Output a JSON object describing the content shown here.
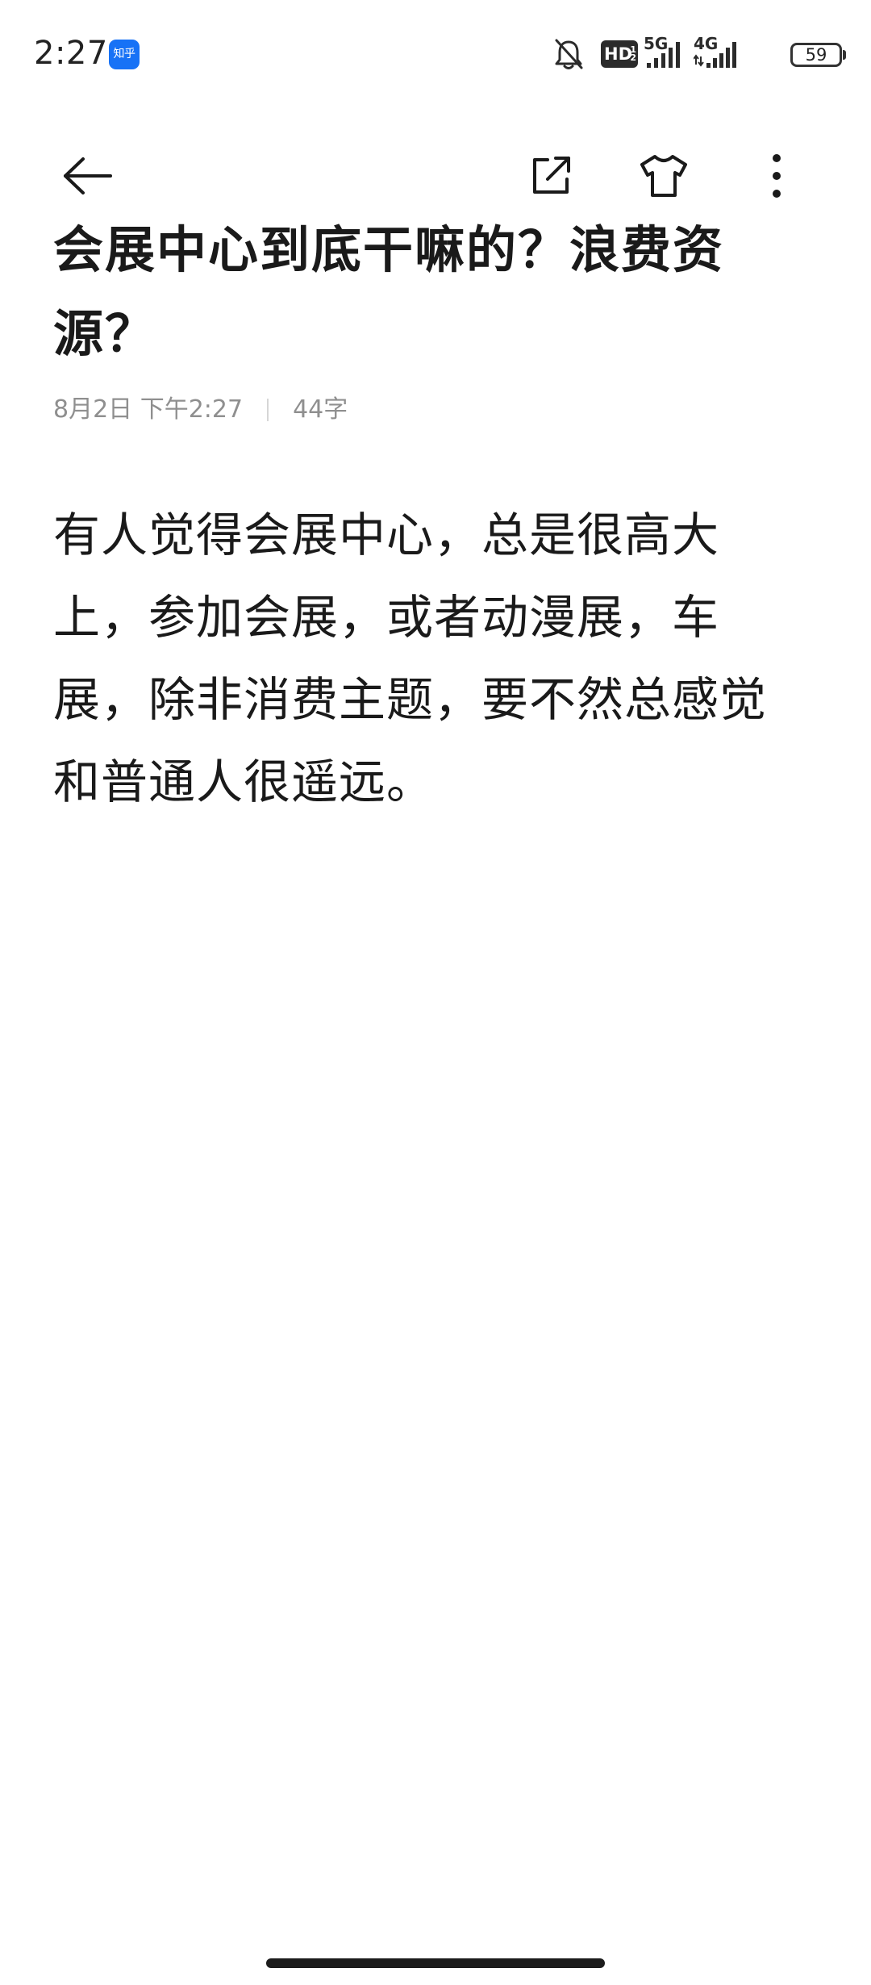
{
  "status_bar": {
    "time": "2:27",
    "app_badge": "知乎",
    "hd_label": "HD",
    "hd_sup": "1",
    "hd_sub": "2",
    "net_primary": "5G",
    "net_secondary": "4G",
    "battery": "59",
    "icons": [
      "bell-off-icon",
      "hd-voice-icon",
      "signal-icon",
      "battery-icon"
    ]
  },
  "nav": {
    "icons": [
      "back-arrow-icon",
      "share-external-icon",
      "tshirt-theme-icon",
      "more-vertical-icon"
    ]
  },
  "article": {
    "title": "会展中心到底干嘛的？浪费资源？",
    "date": "8月2日 下午2:27",
    "word_count": "44字",
    "body": "有人觉得会展中心，总是很高大上，参加会展，或者动漫展，车展，除非消费主题，要不然总感觉和普通人很遥远。"
  },
  "colors": {
    "text": "#1a1a1a",
    "meta": "#8f8f8f",
    "app_badge": "#1772f6",
    "background": "#ffffff"
  }
}
